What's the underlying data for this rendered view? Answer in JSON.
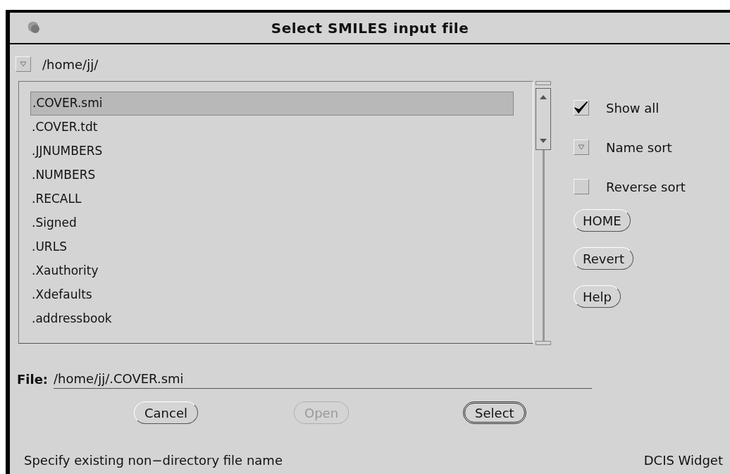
{
  "window": {
    "title": "Select SMILES input file"
  },
  "path": {
    "value": "/home/jj/"
  },
  "files": [
    {
      "name": ".COVER.smi",
      "selected": true
    },
    {
      "name": ".COVER.tdt",
      "selected": false
    },
    {
      "name": ".JJNUMBERS",
      "selected": false
    },
    {
      "name": ".NUMBERS",
      "selected": false
    },
    {
      "name": ".RECALL",
      "selected": false
    },
    {
      "name": ".Signed",
      "selected": false
    },
    {
      "name": ".URLS",
      "selected": false
    },
    {
      "name": ".Xauthority",
      "selected": false
    },
    {
      "name": ".Xdefaults",
      "selected": false
    },
    {
      "name": ".addressbook",
      "selected": false
    }
  ],
  "options": [
    {
      "kind": "checkbox",
      "label": "Show all",
      "checked": true
    },
    {
      "kind": "menu",
      "label": "Name sort"
    },
    {
      "kind": "checkbox",
      "label": "Reverse sort",
      "checked": false
    }
  ],
  "side_buttons": [
    "HOME",
    "Revert",
    "Help"
  ],
  "file_field": {
    "label": "File:",
    "value": "/home/jj/.COVER.smi"
  },
  "buttons": [
    {
      "label": "Cancel",
      "disabled": false,
      "default": false
    },
    {
      "label": "Open",
      "disabled": true,
      "default": false
    },
    {
      "label": "Select",
      "disabled": false,
      "default": true
    }
  ],
  "status_bar": {
    "message": "Specify existing non−directory file name",
    "source": "DCIS Widget"
  }
}
